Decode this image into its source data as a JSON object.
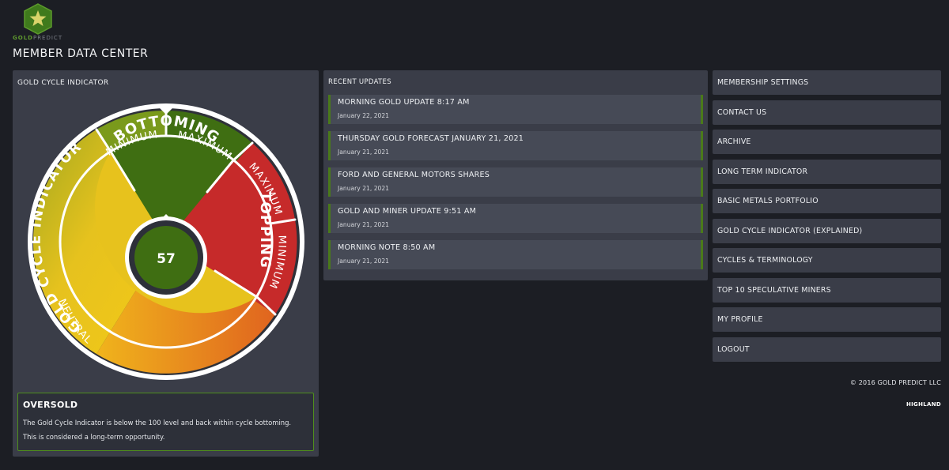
{
  "brand": {
    "logo_gold": "GOLD",
    "logo_predict": "PREDICT",
    "logo_color": "#3f7a1c"
  },
  "page_title": "MEMBER DATA CENTER",
  "gold_cycle": {
    "panel_title": "GOLD CYCLE INDICATOR",
    "value": "57",
    "ring_labels": {
      "minimum_top": "MINIMUM",
      "maximum_top": "MAXIMUM",
      "maximum_right": "MAXIMUM",
      "minimum_right": "MINIMUM",
      "neutral": "NEUTRAL"
    },
    "segment_labels": {
      "bottoming": "BOTTOMING",
      "topping": "TOPPING",
      "gold_cycle_indicator": "GOLD CYCLE INDICATOR"
    },
    "status": {
      "title": "OVERSOLD",
      "line1": "The Gold Cycle Indicator is below the 100 level and back within cycle bottoming.",
      "line2": "This is considered a long-term opportunity."
    },
    "colors": {
      "bottoming": "#3f6e12",
      "topping": "#c62a2a",
      "neutral_yellow": "#e7c21d",
      "accent_border": "#4f8f1c"
    }
  },
  "recent_updates": {
    "panel_title": "RECENT UPDATES",
    "items": [
      {
        "title": "MORNING GOLD UPDATE 8:17 AM",
        "date": "January 22, 2021"
      },
      {
        "title": "THURSDAY GOLD FORECAST JANUARY 21, 2021",
        "date": "January 21, 2021"
      },
      {
        "title": "FORD AND GENERAL MOTORS SHARES",
        "date": "January 21, 2021"
      },
      {
        "title": "GOLD AND MINER UPDATE 9:51 AM",
        "date": "January 21, 2021"
      },
      {
        "title": "MORNING NOTE 8:50 AM",
        "date": "January 21, 2021"
      }
    ]
  },
  "menu": {
    "items": [
      "MEMBERSHIP SETTINGS",
      "CONTACT US",
      "ARCHIVE",
      "LONG TERM INDICATOR",
      "BASIC METALS PORTFOLIO",
      "GOLD CYCLE INDICATOR (EXPLAINED)",
      "CYCLES & TERMINOLOGY",
      "TOP 10 SPECULATIVE MINERS",
      "MY PROFILE",
      "LOGOUT"
    ]
  },
  "footer": {
    "copyright": "© 2016 GOLD PREDICT LLC",
    "credit": "HIGHLAND"
  }
}
